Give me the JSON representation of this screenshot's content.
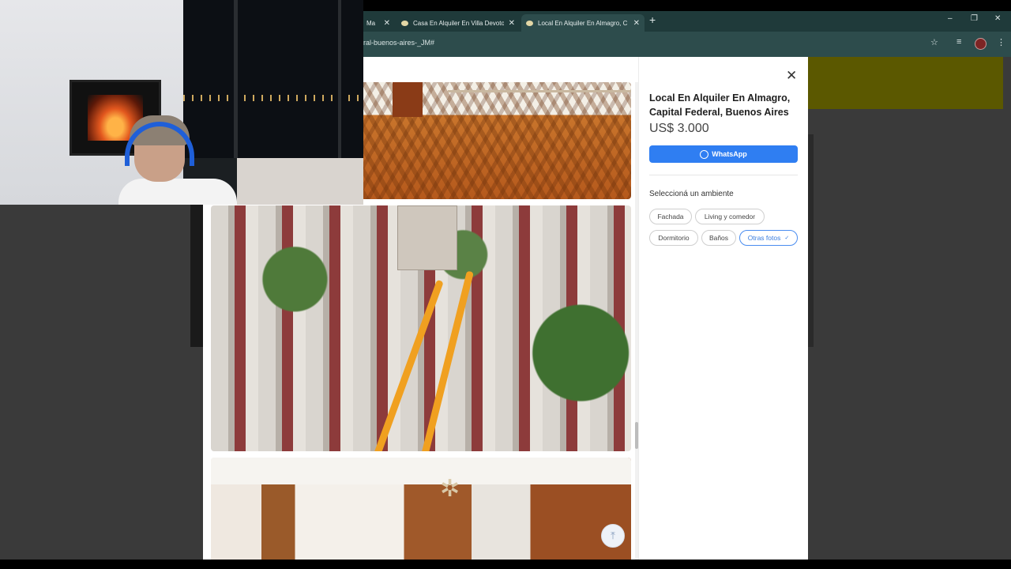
{
  "browser": {
    "tabs": [
      {
        "title": "Ma",
        "active": false
      },
      {
        "title": "Casa En Alquiler En Villa Devoto",
        "active": false
      },
      {
        "title": "Local En Alquiler En Almagro, C",
        "active": true
      }
    ],
    "new_tab_glyph": "+",
    "close_glyph": "✕",
    "window_controls": [
      "–",
      "❐",
      "✕"
    ],
    "url": "ral-buenos-aires-_JM#",
    "toolbar_icons": [
      "star-icon",
      "media-icon",
      "profile-avatar",
      "menu-icon"
    ]
  },
  "listing": {
    "title": "Local En Alquiler En Almagro, Capital Federal, Buenos Aires",
    "price": "US$ 3.000",
    "whatsapp_label": "WhatsApp",
    "select_room_label": "Seleccioná un ambiente",
    "rooms": [
      {
        "label": "Fachada",
        "selected": false
      },
      {
        "label": "Living y comedor",
        "selected": false
      },
      {
        "label": "Dormitorio",
        "selected": false
      },
      {
        "label": "Baños",
        "selected": false
      },
      {
        "label": "Otras fotos",
        "selected": true
      }
    ],
    "selected_check": "✓",
    "close_glyph": "✕",
    "scroll_top_glyph": "⤒"
  },
  "colors": {
    "accent": "#2f7ef2",
    "tab_strip": "#1f3a3a",
    "toolbar": "#2d4c4c",
    "highlight_stripes": "#f0a020"
  }
}
